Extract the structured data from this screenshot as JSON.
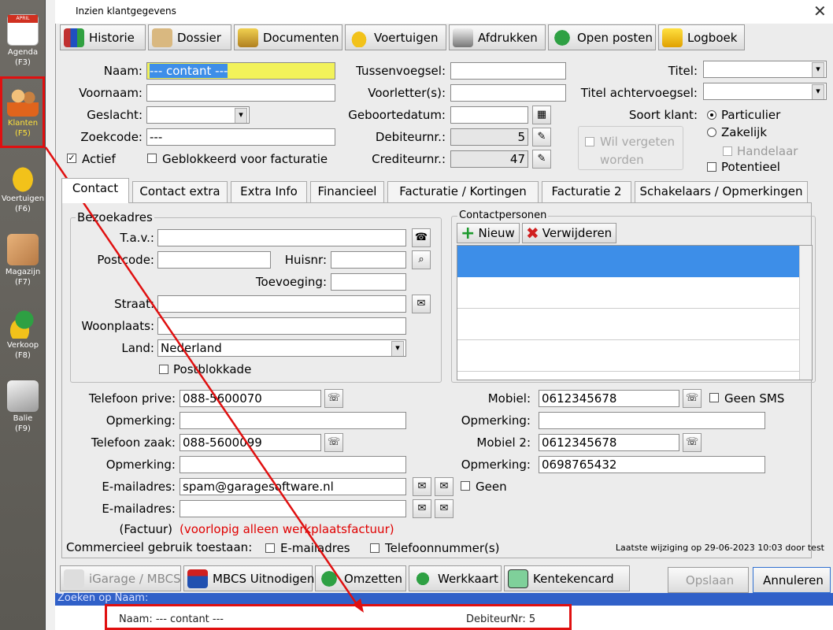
{
  "sidebar": {
    "items": [
      {
        "label": "Agenda",
        "key": "(F3)",
        "icon": "calendar-icon",
        "badge": "APRIL"
      },
      {
        "label": "Klanten",
        "key": "(F5)",
        "icon": "users-icon"
      },
      {
        "label": "Voertuigen",
        "key": "(F6)",
        "icon": "car-icon"
      },
      {
        "label": "Magazijn",
        "key": "(F7)",
        "icon": "box-icon"
      },
      {
        "label": "Verkoop",
        "key": "(F8)",
        "icon": "euro-car-icon"
      },
      {
        "label": "Balie",
        "key": "(F9)",
        "icon": "register-icon"
      }
    ]
  },
  "window": {
    "title": "Inzien klantgegevens",
    "close": "✕"
  },
  "toolbar": {
    "historie": "Historie",
    "dossier": "Dossier",
    "documenten": "Documenten",
    "voertuigen": "Voertuigen",
    "afdrukken": "Afdrukken",
    "open_posten": "Open posten",
    "logboek": "Logboek"
  },
  "form": {
    "naam_label": "Naam:",
    "naam_value": "--- contant ---",
    "voornaam_label": "Voornaam:",
    "voornaam_value": "",
    "geslacht_label": "Geslacht:",
    "geslacht_value": "",
    "zoekcode_label": "Zoekcode:",
    "zoekcode_value": "---",
    "actief_label": "Actief",
    "geblokkeerd_label": "Geblokkeerd voor facturatie",
    "tussenvoegsel_label": "Tussenvoegsel:",
    "voorletters_label": "Voorletter(s):",
    "geboortedatum_label": "Geboortedatum:",
    "debiteurnr_label": "Debiteurnr.:",
    "debiteurnr_value": "5",
    "crediteurnr_label": "Crediteurnr.:",
    "crediteurnr_value": "47",
    "titel_label": "Titel:",
    "titel_achter_label": "Titel achtervoegsel:",
    "soort_klant_label": "Soort klant:",
    "particulier": "Particulier",
    "zakelijk": "Zakelijk",
    "handelaar": "Handelaar",
    "potentieel": "Potentieel",
    "vergeten_line1": "Wil vergeten",
    "vergeten_line2": "worden"
  },
  "tabs": [
    "Contact",
    "Contact extra",
    "Extra Info",
    "Financieel",
    "Facturatie / Kortingen",
    "Facturatie 2",
    "Schakelaars / Opmerkingen"
  ],
  "bezoek": {
    "title": "Bezoekadres",
    "tav": "T.a.v.:",
    "postcode": "Postcode:",
    "huisnr": "Huisnr:",
    "toevoeging": "Toevoeging:",
    "straat": "Straat:",
    "woonplaats": "Woonplaats:",
    "land": "Land:",
    "land_value": "Nederland",
    "postblokkade": "Postblokkade"
  },
  "contactpersonen": {
    "title": "Contactpersonen",
    "nieuw": "Nieuw",
    "verwijderen": "Verwijderen"
  },
  "contact": {
    "tel_prive_label": "Telefoon prive:",
    "tel_prive": "088-5600070",
    "opm_label": "Opmerking:",
    "tel_zaak_label": "Telefoon zaak:",
    "tel_zaak": "088-5600099",
    "email_label": "E-mailadres:",
    "email1": "spam@garagesoftware.nl",
    "factuur_label": "(Factuur)",
    "factuur_note": "(voorlopig alleen werkplaatsfactuur)",
    "mobiel_label": "Mobiel:",
    "mobiel": "0612345678",
    "geen_sms": "Geen SMS",
    "mobiel2_label": "Mobiel 2:",
    "mobiel2": "0612345678",
    "opm3_value": "0698765432",
    "geen": "Geen",
    "commercieel": "Commercieel gebruik toestaan:",
    "c_email": "E-mailadres",
    "c_tel": "Telefoonnummer(s)",
    "laatste": "Laatste wijziging op 29-06-2023 10:03 door test"
  },
  "bottom_buttons": {
    "igarage": "iGarage / MBCS",
    "mbcs": "MBCS Uitnodigen",
    "omzetten": "Omzetten",
    "werkkaart": "Werkkaart",
    "kentekencard": "Kentekencard",
    "opslaan": "Opslaan",
    "annuleren": "Annuleren"
  },
  "status": {
    "zoeken": "Zoeken op Naam:",
    "naam": "Naam: --- contant ---",
    "debiteur": "DebiteurNr: 5"
  },
  "colors": {
    "accent_red": "#e01010",
    "highlight_yellow": "#f2f25a",
    "selection_blue": "#3d8ee8"
  }
}
